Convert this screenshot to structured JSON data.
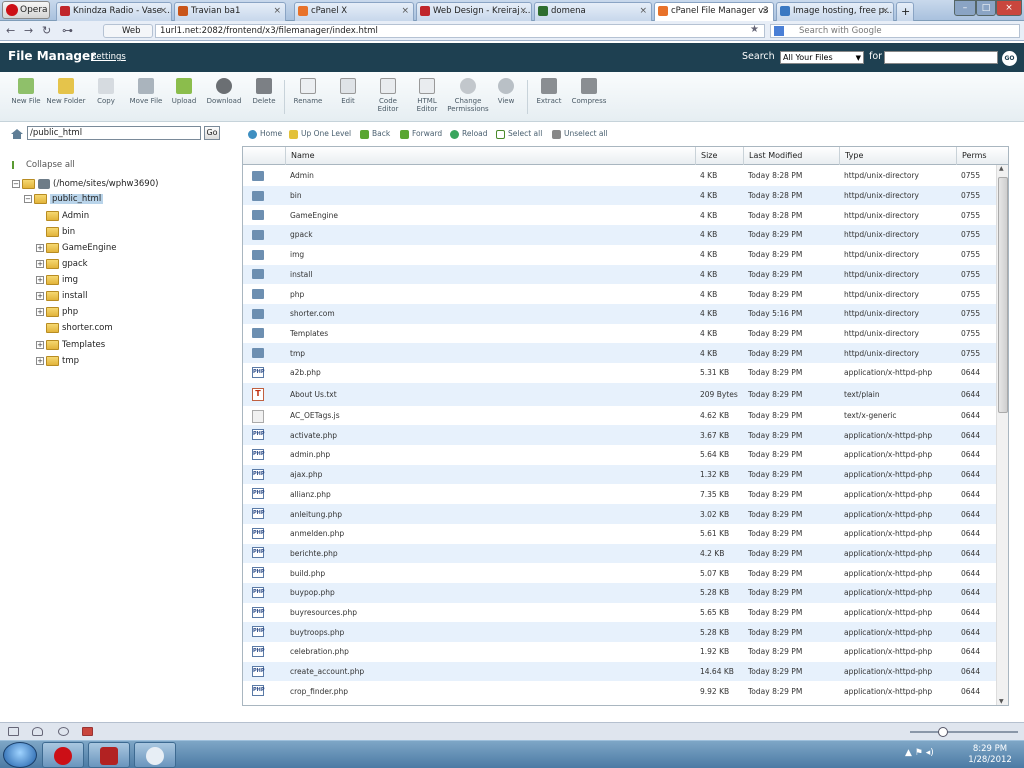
{
  "browser": {
    "menu_label": "Opera",
    "tabs": [
      {
        "label": "Knindza Radio - Vase ..."
      },
      {
        "label": "Travian ba1"
      },
      {
        "label": "cPanel X"
      },
      {
        "label": "Web Design - Kreiraj ..."
      },
      {
        "label": "domena"
      },
      {
        "label": "cPanel File Manager v3"
      },
      {
        "label": "Image hosting, free p..."
      }
    ],
    "web_badge": "Web",
    "url": "1url1.net:2082/frontend/x3/filemanager/index.html",
    "search_placeholder": "Search with Google"
  },
  "header": {
    "title": "File Manager",
    "settings": "Settings",
    "search_label": "Search",
    "search_scope": "All Your Files",
    "for_label": "for",
    "go_label": "GO"
  },
  "toolbar": [
    {
      "label": "New File",
      "icon": "new-file-icon"
    },
    {
      "label": "New Folder",
      "icon": "new-folder-icon"
    },
    {
      "label": "Copy",
      "icon": "copy-icon"
    },
    {
      "label": "Move File",
      "icon": "move-file-icon"
    },
    {
      "label": "Upload",
      "icon": "upload-icon"
    },
    {
      "label": "Download",
      "icon": "download-icon"
    },
    {
      "label": "Delete",
      "icon": "delete-icon"
    },
    {
      "label": "Rename",
      "icon": "rename-icon"
    },
    {
      "label": "Edit",
      "icon": "edit-icon"
    },
    {
      "label": "Code Editor",
      "icon": "code-editor-icon"
    },
    {
      "label": "HTML Editor",
      "icon": "html-editor-icon"
    },
    {
      "label": "Change Permissions",
      "icon": "permissions-icon"
    },
    {
      "label": "View",
      "icon": "view-icon"
    },
    {
      "label": "Extract",
      "icon": "extract-icon"
    },
    {
      "label": "Compress",
      "icon": "compress-icon"
    }
  ],
  "path": {
    "value": "/public_html",
    "go": "Go"
  },
  "tree": {
    "collapse_all": "Collapse all",
    "root": "(/home/sites/wphw3690)",
    "current": "public_html",
    "children": [
      {
        "name": "Admin",
        "expandable": false
      },
      {
        "name": "bin",
        "expandable": false
      },
      {
        "name": "GameEngine",
        "expandable": true
      },
      {
        "name": "gpack",
        "expandable": true
      },
      {
        "name": "img",
        "expandable": true
      },
      {
        "name": "install",
        "expandable": true
      },
      {
        "name": "php",
        "expandable": true
      },
      {
        "name": "shorter.com",
        "expandable": false
      },
      {
        "name": "Templates",
        "expandable": true
      },
      {
        "name": "tmp",
        "expandable": true
      }
    ]
  },
  "actions": [
    {
      "label": "Home"
    },
    {
      "label": "Up One Level"
    },
    {
      "label": "Back"
    },
    {
      "label": "Forward"
    },
    {
      "label": "Reload"
    },
    {
      "label": "Select all"
    },
    {
      "label": "Unselect all"
    }
  ],
  "table": {
    "columns": [
      "Name",
      "Size",
      "Last Modified",
      "Type",
      "Perms"
    ],
    "rows": [
      {
        "icon": "dir",
        "name": "Admin",
        "size": "4 KB",
        "modified": "Today 8:28 PM",
        "type": "httpd/unix-directory",
        "perms": "0755"
      },
      {
        "icon": "dir",
        "name": "bin",
        "size": "4 KB",
        "modified": "Today 8:28 PM",
        "type": "httpd/unix-directory",
        "perms": "0755"
      },
      {
        "icon": "dir",
        "name": "GameEngine",
        "size": "4 KB",
        "modified": "Today 8:28 PM",
        "type": "httpd/unix-directory",
        "perms": "0755"
      },
      {
        "icon": "dir",
        "name": "gpack",
        "size": "4 KB",
        "modified": "Today 8:29 PM",
        "type": "httpd/unix-directory",
        "perms": "0755"
      },
      {
        "icon": "dir",
        "name": "img",
        "size": "4 KB",
        "modified": "Today 8:29 PM",
        "type": "httpd/unix-directory",
        "perms": "0755"
      },
      {
        "icon": "dir",
        "name": "install",
        "size": "4 KB",
        "modified": "Today 8:29 PM",
        "type": "httpd/unix-directory",
        "perms": "0755"
      },
      {
        "icon": "dir",
        "name": "php",
        "size": "4 KB",
        "modified": "Today 8:29 PM",
        "type": "httpd/unix-directory",
        "perms": "0755"
      },
      {
        "icon": "dir",
        "name": "shorter.com",
        "size": "4 KB",
        "modified": "Today 5:16 PM",
        "type": "httpd/unix-directory",
        "perms": "0755"
      },
      {
        "icon": "dir",
        "name": "Templates",
        "size": "4 KB",
        "modified": "Today 8:29 PM",
        "type": "httpd/unix-directory",
        "perms": "0755"
      },
      {
        "icon": "dir",
        "name": "tmp",
        "size": "4 KB",
        "modified": "Today 8:29 PM",
        "type": "httpd/unix-directory",
        "perms": "0755"
      },
      {
        "icon": "php",
        "name": "a2b.php",
        "size": "5.31 KB",
        "modified": "Today 8:29 PM",
        "type": "application/x-httpd-php",
        "perms": "0644"
      },
      {
        "icon": "txt",
        "name": "About Us.txt",
        "size": "209 Bytes",
        "modified": "Today 8:29 PM",
        "type": "text/plain",
        "perms": "0644"
      },
      {
        "icon": "gen",
        "name": "AC_OETags.js",
        "size": "4.62 KB",
        "modified": "Today 8:29 PM",
        "type": "text/x-generic",
        "perms": "0644"
      },
      {
        "icon": "php",
        "name": "activate.php",
        "size": "3.67 KB",
        "modified": "Today 8:29 PM",
        "type": "application/x-httpd-php",
        "perms": "0644"
      },
      {
        "icon": "php",
        "name": "admin.php",
        "size": "5.64 KB",
        "modified": "Today 8:29 PM",
        "type": "application/x-httpd-php",
        "perms": "0644"
      },
      {
        "icon": "php",
        "name": "ajax.php",
        "size": "1.32 KB",
        "modified": "Today 8:29 PM",
        "type": "application/x-httpd-php",
        "perms": "0644"
      },
      {
        "icon": "php",
        "name": "allianz.php",
        "size": "7.35 KB",
        "modified": "Today 8:29 PM",
        "type": "application/x-httpd-php",
        "perms": "0644"
      },
      {
        "icon": "php",
        "name": "anleitung.php",
        "size": "3.02 KB",
        "modified": "Today 8:29 PM",
        "type": "application/x-httpd-php",
        "perms": "0644"
      },
      {
        "icon": "php",
        "name": "anmelden.php",
        "size": "5.61 KB",
        "modified": "Today 8:29 PM",
        "type": "application/x-httpd-php",
        "perms": "0644"
      },
      {
        "icon": "php",
        "name": "berichte.php",
        "size": "4.2 KB",
        "modified": "Today 8:29 PM",
        "type": "application/x-httpd-php",
        "perms": "0644"
      },
      {
        "icon": "php",
        "name": "build.php",
        "size": "5.07 KB",
        "modified": "Today 8:29 PM",
        "type": "application/x-httpd-php",
        "perms": "0644"
      },
      {
        "icon": "php",
        "name": "buypop.php",
        "size": "5.28 KB",
        "modified": "Today 8:29 PM",
        "type": "application/x-httpd-php",
        "perms": "0644"
      },
      {
        "icon": "php",
        "name": "buyresources.php",
        "size": "5.65 KB",
        "modified": "Today 8:29 PM",
        "type": "application/x-httpd-php",
        "perms": "0644"
      },
      {
        "icon": "php",
        "name": "buytroops.php",
        "size": "5.28 KB",
        "modified": "Today 8:29 PM",
        "type": "application/x-httpd-php",
        "perms": "0644"
      },
      {
        "icon": "php",
        "name": "celebration.php",
        "size": "1.92 KB",
        "modified": "Today 8:29 PM",
        "type": "application/x-httpd-php",
        "perms": "0644"
      },
      {
        "icon": "php",
        "name": "create_account.php",
        "size": "14.64 KB",
        "modified": "Today 8:29 PM",
        "type": "application/x-httpd-php",
        "perms": "0644"
      },
      {
        "icon": "php",
        "name": "crop_finder.php",
        "size": "9.92 KB",
        "modified": "Today 8:29 PM",
        "type": "application/x-httpd-php",
        "perms": "0644"
      }
    ]
  },
  "taskbar": {
    "time": "8:29 PM",
    "date": "1/28/2012"
  },
  "colors": {
    "header": "#1e4051",
    "row_alt": "#e7f1fc",
    "opera_red": "#cc0f16"
  }
}
